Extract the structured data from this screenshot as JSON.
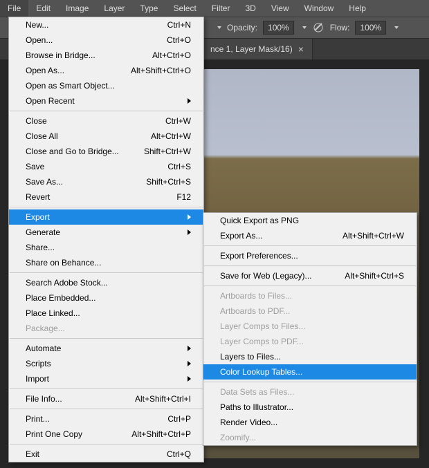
{
  "menubar": {
    "items": [
      {
        "label": "File"
      },
      {
        "label": "Edit"
      },
      {
        "label": "Image"
      },
      {
        "label": "Layer"
      },
      {
        "label": "Type"
      },
      {
        "label": "Select"
      },
      {
        "label": "Filter"
      },
      {
        "label": "3D"
      },
      {
        "label": "View"
      },
      {
        "label": "Window"
      },
      {
        "label": "Help"
      }
    ]
  },
  "toolbar": {
    "opacity_label": "Opacity:",
    "opacity_value": "100%",
    "flow_label": "Flow:",
    "flow_value": "100%"
  },
  "doctab": {
    "title": "nce 1, Layer Mask/16)",
    "close": "×"
  },
  "colors": {
    "highlight": "#1e89e5"
  },
  "file_menu": {
    "groups": [
      [
        {
          "label": "New...",
          "accel": "Ctrl+N"
        },
        {
          "label": "Open...",
          "accel": "Ctrl+O"
        },
        {
          "label": "Browse in Bridge...",
          "accel": "Alt+Ctrl+O"
        },
        {
          "label": "Open As...",
          "accel": "Alt+Shift+Ctrl+O"
        },
        {
          "label": "Open as Smart Object..."
        },
        {
          "label": "Open Recent",
          "submenu": true
        }
      ],
      [
        {
          "label": "Close",
          "accel": "Ctrl+W"
        },
        {
          "label": "Close All",
          "accel": "Alt+Ctrl+W"
        },
        {
          "label": "Close and Go to Bridge...",
          "accel": "Shift+Ctrl+W"
        },
        {
          "label": "Save",
          "accel": "Ctrl+S"
        },
        {
          "label": "Save As...",
          "accel": "Shift+Ctrl+S"
        },
        {
          "label": "Revert",
          "accel": "F12"
        }
      ],
      [
        {
          "label": "Export",
          "submenu": true,
          "hl": true
        },
        {
          "label": "Generate",
          "submenu": true
        },
        {
          "label": "Share..."
        },
        {
          "label": "Share on Behance..."
        }
      ],
      [
        {
          "label": "Search Adobe Stock..."
        },
        {
          "label": "Place Embedded..."
        },
        {
          "label": "Place Linked..."
        },
        {
          "label": "Package...",
          "disabled": true
        }
      ],
      [
        {
          "label": "Automate",
          "submenu": true
        },
        {
          "label": "Scripts",
          "submenu": true
        },
        {
          "label": "Import",
          "submenu": true
        }
      ],
      [
        {
          "label": "File Info...",
          "accel": "Alt+Shift+Ctrl+I"
        }
      ],
      [
        {
          "label": "Print...",
          "accel": "Ctrl+P"
        },
        {
          "label": "Print One Copy",
          "accel": "Alt+Shift+Ctrl+P"
        }
      ],
      [
        {
          "label": "Exit",
          "accel": "Ctrl+Q"
        }
      ]
    ]
  },
  "export_menu": {
    "groups": [
      [
        {
          "label": "Quick Export as PNG"
        },
        {
          "label": "Export As...",
          "accel": "Alt+Shift+Ctrl+W"
        }
      ],
      [
        {
          "label": "Export Preferences..."
        }
      ],
      [
        {
          "label": "Save for Web (Legacy)...",
          "accel": "Alt+Shift+Ctrl+S"
        }
      ],
      [
        {
          "label": "Artboards to Files...",
          "disabled": true
        },
        {
          "label": "Artboards to PDF...",
          "disabled": true
        },
        {
          "label": "Layer Comps to Files...",
          "disabled": true
        },
        {
          "label": "Layer Comps to PDF...",
          "disabled": true
        },
        {
          "label": "Layers to Files..."
        },
        {
          "label": "Color Lookup Tables...",
          "hl": true
        }
      ],
      [
        {
          "label": "Data Sets as Files...",
          "disabled": true
        },
        {
          "label": "Paths to Illustrator..."
        },
        {
          "label": "Render Video..."
        },
        {
          "label": "Zoomify...",
          "disabled": true
        }
      ]
    ]
  }
}
